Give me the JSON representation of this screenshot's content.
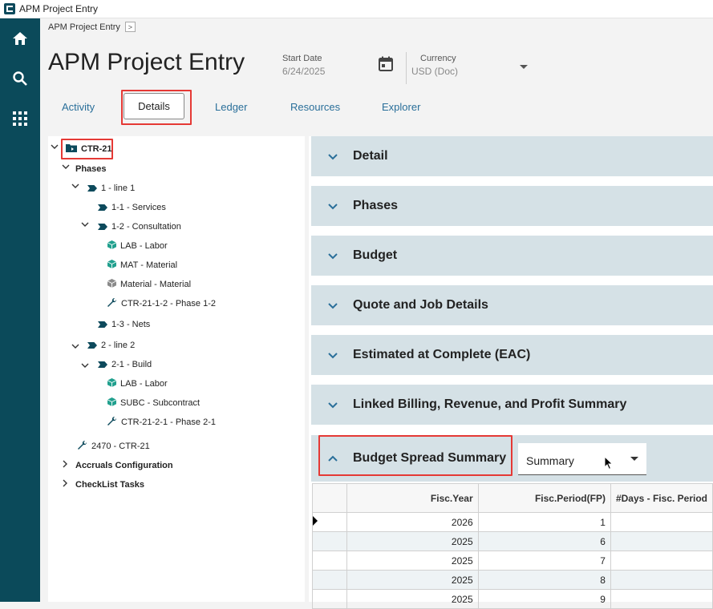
{
  "window": {
    "title": "APM Project Entry"
  },
  "breadcrumb": {
    "text": "APM Project Entry",
    "nav": ">"
  },
  "header": {
    "title": "APM Project Entry",
    "start_date_label": "Start Date",
    "start_date_value": "6/24/2025",
    "currency_label": "Currency",
    "currency_value": "USD (Doc)"
  },
  "tabs": [
    "Activity",
    "Details",
    "Ledger",
    "Resources",
    "Explorer"
  ],
  "tree": {
    "root": "CTR-21",
    "phases": "Phases",
    "line1": "1 - line 1",
    "services": "1-1 - Services",
    "consultation": "1-2 - Consultation",
    "lab1": "LAB - Labor",
    "mat1": "MAT - Material",
    "matmat": "Material - Material",
    "ph12": "CTR-21-1-2 - Phase 1-2",
    "nets": "1-3 - Nets",
    "line2": "2 - line 2",
    "build": "2-1 - Build",
    "lab2": "LAB - Labor",
    "subc": "SUBC - Subcontract",
    "ph21": "CTR-21-2-1 - Phase 2-1",
    "ctr2470": "2470 - CTR-21",
    "accruals": "Accruals Configuration",
    "checklist": "CheckList Tasks"
  },
  "sections": [
    "Detail",
    "Phases",
    "Budget",
    "Quote and Job Details",
    "Estimated at Complete (EAC)",
    "Linked Billing, Revenue, and Profit Summary"
  ],
  "budget_spread": {
    "title": "Budget Spread Summary",
    "view": "Summary"
  },
  "grid": {
    "columns": [
      "Fisc.Year",
      "Fisc.Period(FP)",
      "#Days - Fisc. Period"
    ],
    "rows": [
      {
        "year": "2026",
        "period": "1"
      },
      {
        "year": "2025",
        "period": "6"
      },
      {
        "year": "2025",
        "period": "7"
      },
      {
        "year": "2025",
        "period": "8"
      },
      {
        "year": "2025",
        "period": "9"
      }
    ]
  }
}
